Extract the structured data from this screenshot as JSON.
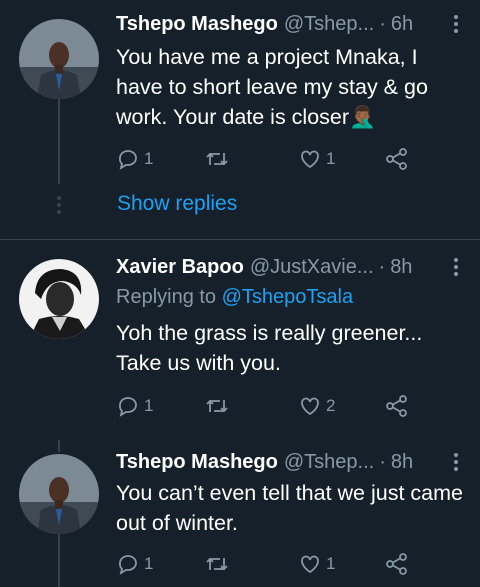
{
  "tweets": [
    {
      "name": "Tshepo Mashego",
      "handle": "@Tshep...",
      "dot": "·",
      "time": "6h",
      "text": "You have me a project Mnaka, I have to short leave my stay & go work. Your date is closer🤦🏾‍♂️",
      "reply_count": "1",
      "retweet_count": "",
      "like_count": "1"
    },
    {
      "name": "Xavier Bapoo",
      "handle": "@JustXavie...",
      "dot": "·",
      "time": "8h",
      "replying_prefix": "Replying to ",
      "replying_to": "@TshepoTsala",
      "text": "Yoh the grass is really greener... Take us with you.",
      "reply_count": "1",
      "retweet_count": "",
      "like_count": "2"
    },
    {
      "name": "Tshepo Mashego",
      "handle": "@Tshep...",
      "dot": "·",
      "time": "8h",
      "text": "You can’t even tell that we just came out of winter.",
      "reply_count": "1",
      "retweet_count": "",
      "like_count": "1"
    }
  ],
  "show_replies": "Show replies",
  "colors": {
    "background": "#15202b",
    "text": "#ffffff",
    "secondary": "#8899a6",
    "link": "#1da1f2",
    "divider": "#38444d"
  },
  "icons": [
    "reply-icon",
    "retweet-icon",
    "like-icon",
    "share-icon",
    "more-icon"
  ]
}
